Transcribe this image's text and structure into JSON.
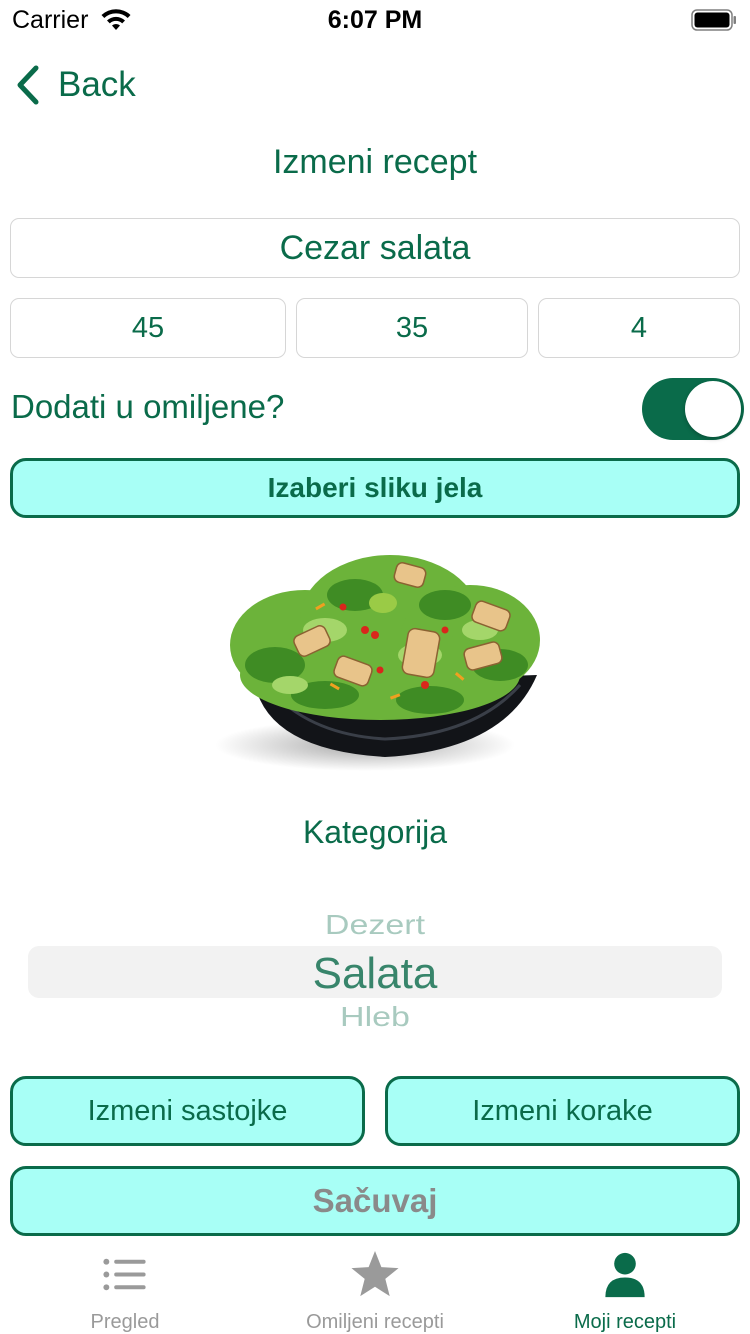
{
  "status_bar": {
    "carrier": "Carrier",
    "time": "6:07 PM"
  },
  "nav": {
    "back_label": "Back"
  },
  "title": "Izmeni recept",
  "form": {
    "name_value": "Cezar salata",
    "number_fields": [
      "45",
      "35",
      "4"
    ],
    "favorite_label": "Dodati u omiljene?",
    "favorite_on": true,
    "pick_image_label": "Izaberi sliku jela"
  },
  "category": {
    "label": "Kategorija",
    "options_visible": [
      "Dezert",
      "Salata",
      "Hleb"
    ],
    "selected": "Salata"
  },
  "actions": {
    "edit_ingredients": "Izmeni sastojke",
    "edit_steps": "Izmeni korake",
    "save": "Sačuvaj"
  },
  "tabs": [
    {
      "label": "Pregled",
      "icon": "list-icon",
      "active": false
    },
    {
      "label": "Omiljeni recepti",
      "icon": "star-icon",
      "active": false
    },
    {
      "label": "Moji recepti",
      "icon": "person-icon",
      "active": true
    }
  ],
  "colors": {
    "accent": "#0a6b4a",
    "button_fill": "#a8fff6",
    "inactive": "#9a9a9a"
  }
}
